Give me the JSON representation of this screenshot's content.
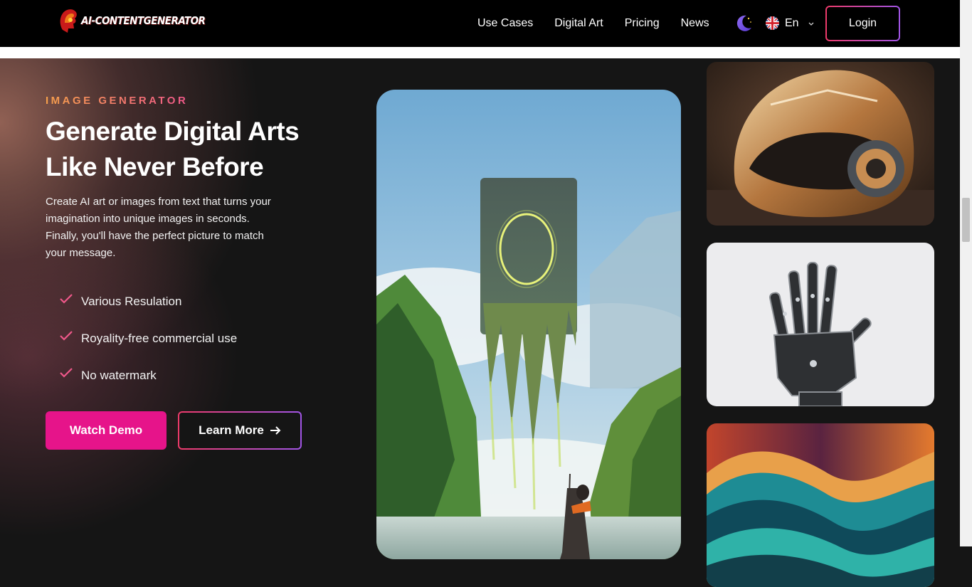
{
  "nav": {
    "logo_text": "AI-CONTENTGENERATOR",
    "links": [
      "Use Cases",
      "Digital Art",
      "Pricing",
      "News"
    ],
    "language": "En",
    "login_label": "Login"
  },
  "hero": {
    "eyebrow": "IMAGE GENERATOR",
    "headline_line1": "Generate Digital Arts",
    "headline_line2": "Like Never Before",
    "lede": "Create AI art or images from text that turns your imagination into unique images in seconds. Finally, you'll have the perfect picture to match your message.",
    "features": [
      "Various Resulation",
      "Royality-free commercial use",
      "No watermark"
    ],
    "watch_demo_label": "Watch Demo",
    "learn_more_label": "Learn More"
  },
  "colors": {
    "accent_pink": "#e6148a",
    "gradient_start": "#ee3a6a",
    "gradient_end": "#a155e6",
    "check_color": "#f0588a",
    "background": "#151515"
  },
  "icons": {
    "theme": "moon-icon",
    "flag": "uk-flag-icon",
    "language_chevron": "chevron-down-icon",
    "feature_check": "check-icon",
    "learn_more": "arrow-right-icon"
  }
}
